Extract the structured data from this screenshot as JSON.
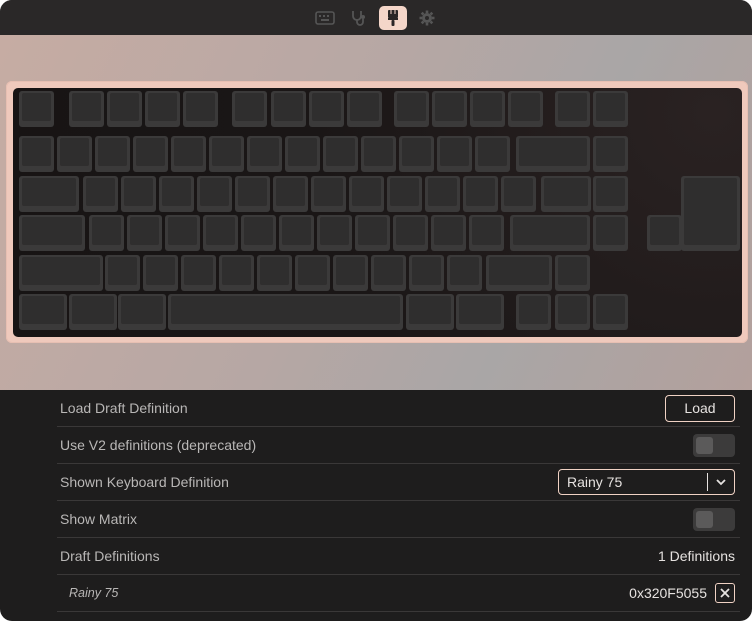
{
  "toolbar": {
    "tabs": [
      {
        "icon": "keyboard-icon",
        "active": false
      },
      {
        "icon": "stethoscope-icon",
        "active": false
      },
      {
        "icon": "paintbrush-icon",
        "active": true
      },
      {
        "icon": "gear-icon",
        "active": false
      }
    ]
  },
  "colors": {
    "accent": "#f4d6c9",
    "frame": "#efc9bc",
    "panel_bg": "#1e1d1d",
    "text": "#b9b7b6"
  },
  "keyboard": {
    "layout_name": "Rainy 75"
  },
  "settings": {
    "load_draft": {
      "label": "Load Draft Definition",
      "button": "Load"
    },
    "v2_defs": {
      "label": "Use V2 definitions (deprecated)",
      "enabled": false
    },
    "shown_def": {
      "label": "Shown Keyboard Definition",
      "selected": "Rainy 75"
    },
    "show_matrix": {
      "label": "Show Matrix",
      "enabled": false
    },
    "draft_defs": {
      "label": "Draft Definitions",
      "count": "1 Definitions"
    },
    "draft_item": {
      "name": "Rainy 75",
      "id": "0x320F5055"
    }
  }
}
